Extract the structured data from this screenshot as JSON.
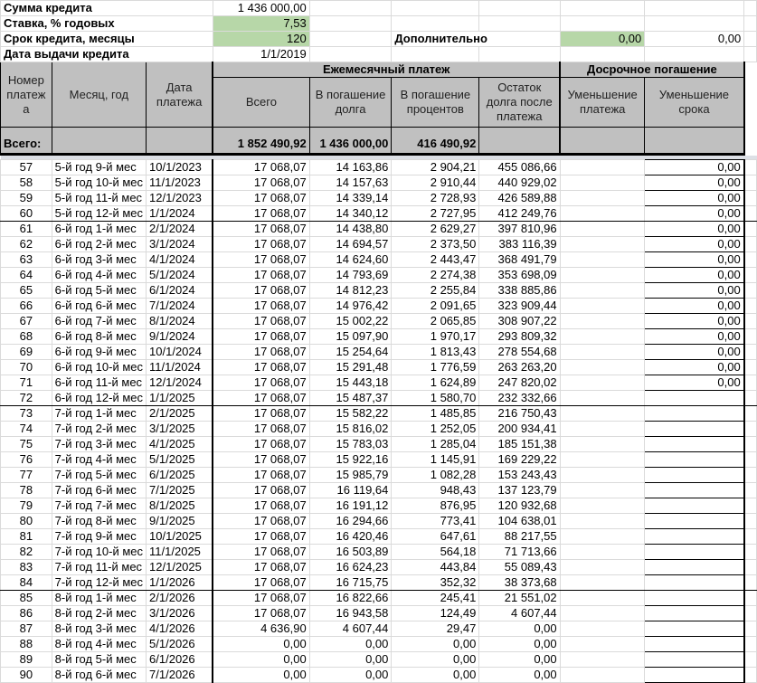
{
  "params": {
    "sum_label": "Сумма кредита",
    "sum_value": "1 436 000,00",
    "rate_label": "Ставка, % годовых",
    "rate_value": "7,53",
    "term_label": "Срок кредита, месяцы",
    "term_value": "120",
    "date_label": "Дата выдачи кредита",
    "date_value": "1/1/2019",
    "extra_label": "Дополнительно",
    "extra_value": "0,00",
    "extra_value2": "0,00"
  },
  "headers": {
    "num": "Номер платежа",
    "month": "Месяц, год",
    "date": "Дата платежа",
    "monthly": "Ежемесячный платеж",
    "early": "Досрочное погашение",
    "total": "Всего",
    "principal": "В погашение долга",
    "interest": "В погашение процентов",
    "balance": "Остаток долга после платежа",
    "reduce_payment": "Уменьшение платежа",
    "reduce_term": "Уменьшение срока"
  },
  "totals": {
    "label": "Всего:",
    "total": "1 852 490,92",
    "principal": "1 436 000,00",
    "interest": "416 490,92"
  },
  "rows": [
    [
      "57",
      "5-й год 9-й мес",
      "10/1/2023",
      "17 068,07",
      "14 163,86",
      "2 904,21",
      "455 086,66",
      "",
      "0,00"
    ],
    [
      "58",
      "5-й год 10-й мес",
      "11/1/2023",
      "17 068,07",
      "14 157,63",
      "2 910,44",
      "440 929,02",
      "",
      "0,00"
    ],
    [
      "59",
      "5-й год 11-й мес",
      "12/1/2023",
      "17 068,07",
      "14 339,14",
      "2 728,93",
      "426 589,88",
      "",
      "0,00"
    ],
    [
      "60",
      "5-й год 12-й мес",
      "1/1/2024",
      "17 068,07",
      "14 340,12",
      "2 727,95",
      "412 249,76",
      "",
      "0,00"
    ],
    [
      "61",
      "6-й год 1-й мес",
      "2/1/2024",
      "17 068,07",
      "14 438,80",
      "2 629,27",
      "397 810,96",
      "",
      "0,00"
    ],
    [
      "62",
      "6-й год 2-й мес",
      "3/1/2024",
      "17 068,07",
      "14 694,57",
      "2 373,50",
      "383 116,39",
      "",
      "0,00"
    ],
    [
      "63",
      "6-й год 3-й мес",
      "4/1/2024",
      "17 068,07",
      "14 624,60",
      "2 443,47",
      "368 491,79",
      "",
      "0,00"
    ],
    [
      "64",
      "6-й год 4-й мес",
      "5/1/2024",
      "17 068,07",
      "14 793,69",
      "2 274,38",
      "353 698,09",
      "",
      "0,00"
    ],
    [
      "65",
      "6-й год 5-й мес",
      "6/1/2024",
      "17 068,07",
      "14 812,23",
      "2 255,84",
      "338 885,86",
      "",
      "0,00"
    ],
    [
      "66",
      "6-й год 6-й мес",
      "7/1/2024",
      "17 068,07",
      "14 976,42",
      "2 091,65",
      "323 909,44",
      "",
      "0,00"
    ],
    [
      "67",
      "6-й год 7-й мес",
      "8/1/2024",
      "17 068,07",
      "15 002,22",
      "2 065,85",
      "308 907,22",
      "",
      "0,00"
    ],
    [
      "68",
      "6-й год 8-й мес",
      "9/1/2024",
      "17 068,07",
      "15 097,90",
      "1 970,17",
      "293 809,32",
      "",
      "0,00"
    ],
    [
      "69",
      "6-й год 9-й мес",
      "10/1/2024",
      "17 068,07",
      "15 254,64",
      "1 813,43",
      "278 554,68",
      "",
      "0,00"
    ],
    [
      "70",
      "6-й год 10-й мес",
      "11/1/2024",
      "17 068,07",
      "15 291,48",
      "1 776,59",
      "263 263,20",
      "",
      "0,00"
    ],
    [
      "71",
      "6-й год 11-й мес",
      "12/1/2024",
      "17 068,07",
      "15 443,18",
      "1 624,89",
      "247 820,02",
      "",
      "0,00"
    ],
    [
      "72",
      "6-й год 12-й мес",
      "1/1/2025",
      "17 068,07",
      "15 487,37",
      "1 580,70",
      "232 332,66",
      "",
      ""
    ],
    [
      "73",
      "7-й год 1-й мес",
      "2/1/2025",
      "17 068,07",
      "15 582,22",
      "1 485,85",
      "216 750,43",
      "",
      ""
    ],
    [
      "74",
      "7-й год 2-й мес",
      "3/1/2025",
      "17 068,07",
      "15 816,02",
      "1 252,05",
      "200 934,41",
      "",
      ""
    ],
    [
      "75",
      "7-й год 3-й мес",
      "4/1/2025",
      "17 068,07",
      "15 783,03",
      "1 285,04",
      "185 151,38",
      "",
      ""
    ],
    [
      "76",
      "7-й год 4-й мес",
      "5/1/2025",
      "17 068,07",
      "15 922,16",
      "1 145,91",
      "169 229,22",
      "",
      ""
    ],
    [
      "77",
      "7-й год 5-й мес",
      "6/1/2025",
      "17 068,07",
      "15 985,79",
      "1 082,28",
      "153 243,43",
      "",
      ""
    ],
    [
      "78",
      "7-й год 6-й мес",
      "7/1/2025",
      "17 068,07",
      "16 119,64",
      "948,43",
      "137 123,79",
      "",
      ""
    ],
    [
      "79",
      "7-й год 7-й мес",
      "8/1/2025",
      "17 068,07",
      "16 191,12",
      "876,95",
      "120 932,68",
      "",
      ""
    ],
    [
      "80",
      "7-й год 8-й мес",
      "9/1/2025",
      "17 068,07",
      "16 294,66",
      "773,41",
      "104 638,01",
      "",
      ""
    ],
    [
      "81",
      "7-й год 9-й мес",
      "10/1/2025",
      "17 068,07",
      "16 420,46",
      "647,61",
      "88 217,55",
      "",
      ""
    ],
    [
      "82",
      "7-й год 10-й мес",
      "11/1/2025",
      "17 068,07",
      "16 503,89",
      "564,18",
      "71 713,66",
      "",
      ""
    ],
    [
      "83",
      "7-й год 11-й мес",
      "12/1/2025",
      "17 068,07",
      "16 624,23",
      "443,84",
      "55 089,43",
      "",
      ""
    ],
    [
      "84",
      "7-й год 12-й мес",
      "1/1/2026",
      "17 068,07",
      "16 715,75",
      "352,32",
      "38 373,68",
      "",
      ""
    ],
    [
      "85",
      "8-й год 1-й мес",
      "2/1/2026",
      "17 068,07",
      "16 822,66",
      "245,41",
      "21 551,02",
      "",
      ""
    ],
    [
      "86",
      "8-й год 2-й мес",
      "3/1/2026",
      "17 068,07",
      "16 943,58",
      "124,49",
      "4 607,44",
      "",
      ""
    ],
    [
      "87",
      "8-й год 3-й мес",
      "4/1/2026",
      "4 636,90",
      "4 607,44",
      "29,47",
      "0,00",
      "",
      ""
    ],
    [
      "88",
      "8-й год 4-й мес",
      "5/1/2026",
      "0,00",
      "0,00",
      "0,00",
      "0,00",
      "",
      ""
    ],
    [
      "89",
      "8-й год 5-й мес",
      "6/1/2026",
      "0,00",
      "0,00",
      "0,00",
      "0,00",
      "",
      ""
    ],
    [
      "90",
      "8-й год 6-й мес",
      "7/1/2026",
      "0,00",
      "0,00",
      "0,00",
      "0,00",
      "",
      ""
    ]
  ]
}
